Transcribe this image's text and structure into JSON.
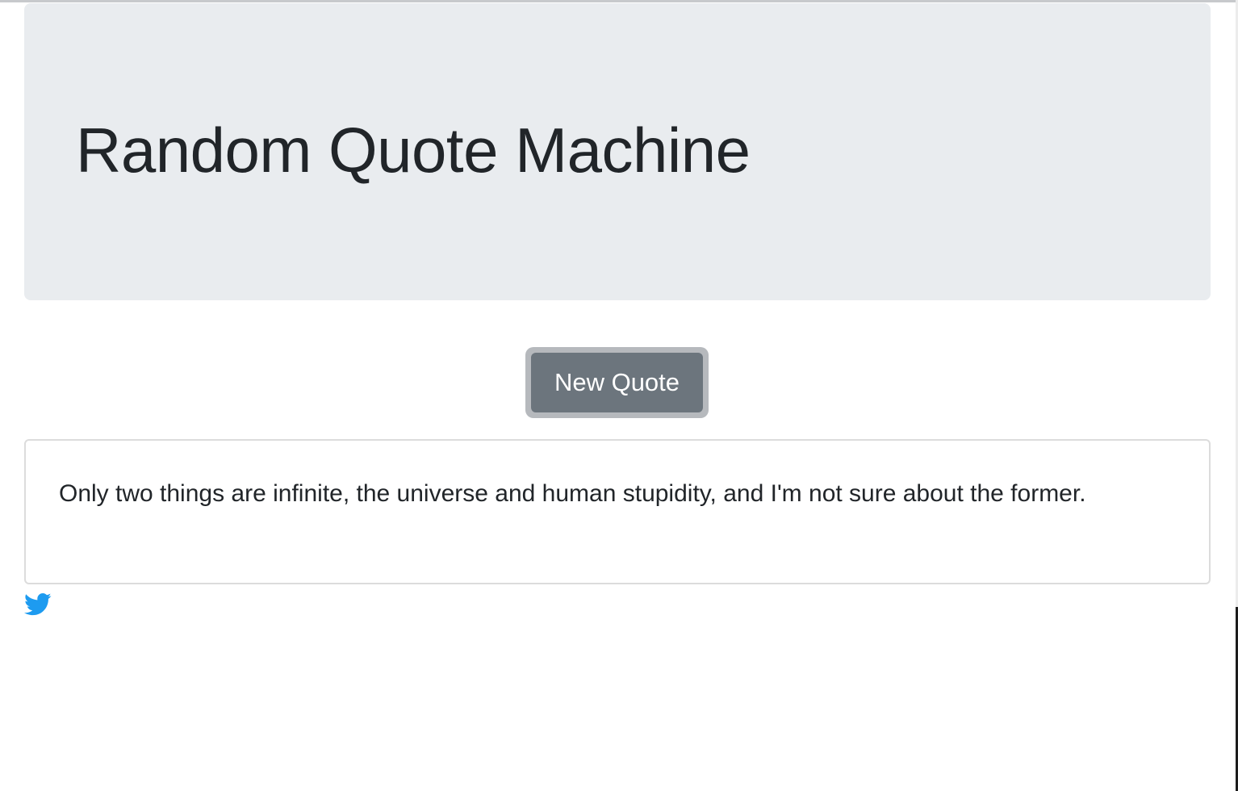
{
  "header": {
    "title": "Random Quote Machine"
  },
  "actions": {
    "new_quote_label": "New Quote"
  },
  "quote": {
    "text": "Only two things are infinite, the universe and human stupidity, and I'm not sure about the former."
  },
  "share": {
    "icon": "twitter-icon",
    "color": "#1da1f2"
  },
  "colors": {
    "jumbotron_bg": "#e9ecef",
    "button_bg": "#6c757d",
    "text": "#212529"
  }
}
